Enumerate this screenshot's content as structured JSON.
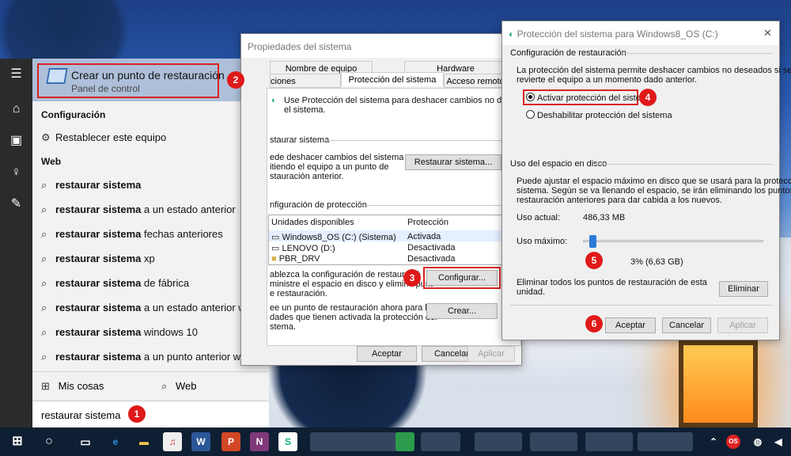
{
  "start_menu": {
    "best_match": {
      "title": "Crear un punto de restauración",
      "subtitle": "Panel de control"
    },
    "section_config": "Configuración",
    "config_item": "Restablecer este equipo",
    "section_web": "Web",
    "web_results": [
      {
        "bold": "restaurar sistema",
        "rest": ""
      },
      {
        "bold": "restaurar sistema",
        "rest": " a un estado anterior"
      },
      {
        "bold": "restaurar sistema",
        "rest": " fechas anteriores"
      },
      {
        "bold": "restaurar sistema",
        "rest": " xp"
      },
      {
        "bold": "restaurar sistema",
        "rest": " de fábrica"
      },
      {
        "bold": "restaurar sistema",
        "rest": " a un estado anterior w8"
      },
      {
        "bold": "restaurar sistema",
        "rest": " windows 10"
      },
      {
        "bold": "restaurar sistema",
        "rest": " a un punto anterior w8.1"
      }
    ],
    "my_stuff": "Mis cosas",
    "web": "Web",
    "search_value": "restaurar sistema"
  },
  "props": {
    "title": "Propiedades del sistema",
    "tabs_top": [
      "Nombre de equipo",
      "Hardware"
    ],
    "tabs_bottom": [
      "ciones avanzadas",
      "Protección del sistema",
      "Acceso remoto"
    ],
    "intro_1": "Use Protección del sistema para deshacer cambios no deseados en",
    "intro_2": "el sistema.",
    "section_restore": "staurar sistema",
    "restore_text": [
      "ede deshacer cambios del sistema",
      "itiendo el equipo a un punto de",
      "stauración anterior."
    ],
    "restore_button": "Restaurar sistema...",
    "section_protection": "nfiguración de protección",
    "col_drives": "Unidades disponibles",
    "col_protection": "Protección",
    "drives": [
      {
        "name": "Windows8_OS (C:) (Sistema)",
        "status": "Activada"
      },
      {
        "name": "LENOVO (D:)",
        "status": "Desactivada"
      },
      {
        "name": "PBR_DRV",
        "status": "Desactivada"
      }
    ],
    "config_text": [
      "ablezca la configuración de restauració",
      "ministre el espacio en disco y elimine punt",
      "e restauración."
    ],
    "config_button": "Configurar...",
    "create_text": [
      "ee un punto de restauración ahora para las",
      "dades que tienen activada la protección del",
      "stema."
    ],
    "create_button": "Crear...",
    "ok": "Aceptar",
    "cancel": "Cancelar",
    "apply": "Aplicar"
  },
  "protect": {
    "title": "Protección del sistema para Windows8_OS (C:)",
    "close": "✕",
    "restore_settings": "Configuración de restauración",
    "restore_desc": [
      "La protección del sistema permite deshacer cambios no deseados si se",
      "revierte el equipo a un momento dado anterior."
    ],
    "opt_on": "Activar protección del sistema",
    "opt_off": "Deshabilitar protección del sistema",
    "disk_usage": "Uso del espacio en disco",
    "disk_desc": [
      "Puede ajustar el espacio máximo en disco que se usará para la protección del",
      "sistema. Según se va llenando el espacio, se irán eliminando los puntos de",
      "restauración anteriores para dar cabida a los nuevos."
    ],
    "current_label": "Uso actual:",
    "current_value": "486,33 MB",
    "max_label": "Uso máximo:",
    "max_value": "3% (6,63 GB)",
    "slider_percent": 3,
    "delete_text": [
      "Eliminar todos los puntos de restauración de esta",
      "unidad."
    ],
    "delete_button": "Eliminar",
    "ok": "Aceptar",
    "cancel": "Cancelar",
    "apply": "Aplicar"
  },
  "badges": [
    "1",
    "2",
    "3",
    "4",
    "5",
    "6"
  ],
  "taskbar": {
    "apps": [
      "W",
      "P",
      "N",
      "S"
    ]
  },
  "colors": {
    "accent_red": "#e01919",
    "taskbar": "#0f1f33"
  }
}
